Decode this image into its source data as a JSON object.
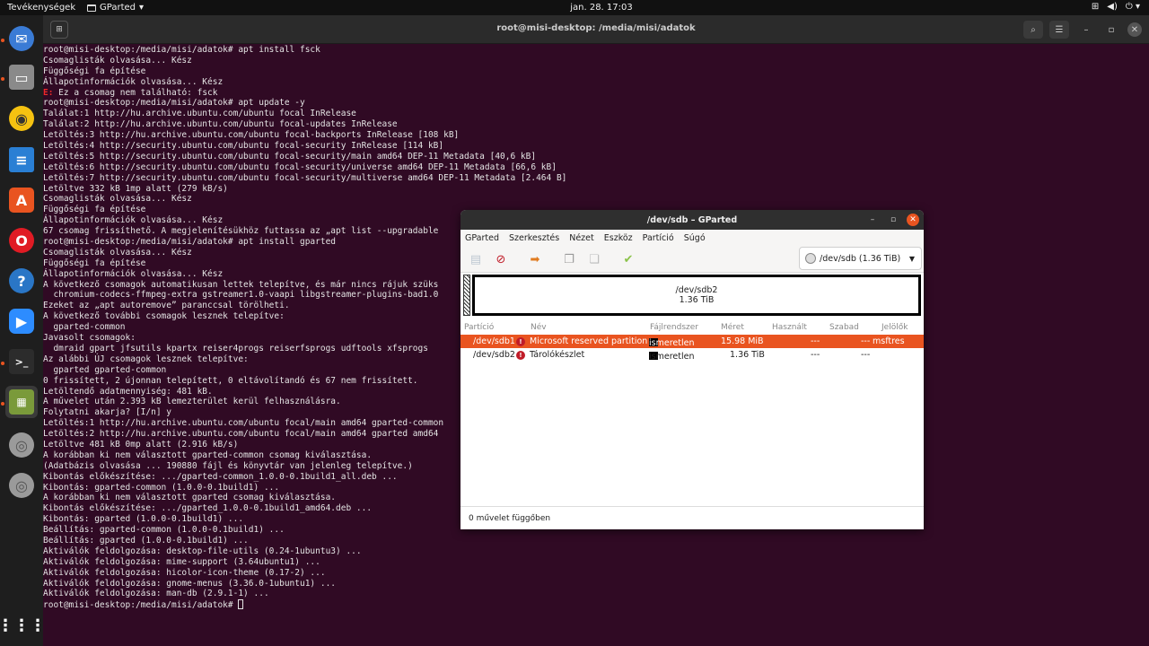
{
  "topbar": {
    "activities": "Tevékenységek",
    "app_name": "GParted",
    "clock": "jan. 28.  17:03",
    "tray_icons": [
      "network-icon",
      "volume-icon",
      "power-icon"
    ]
  },
  "dock": {
    "items": [
      {
        "name": "Thunderbird",
        "icon": "mail-icon",
        "color": "#3a7bd5"
      },
      {
        "name": "Files",
        "icon": "folder-icon",
        "color": "#8a8a8a"
      },
      {
        "name": "Rhythmbox",
        "icon": "music-icon",
        "color": "#f5c211"
      },
      {
        "name": "LibreOffice Writer",
        "icon": "writer-icon",
        "color": "#2a7fd4"
      },
      {
        "name": "Ubuntu Software",
        "icon": "software-icon",
        "color": "#e95420"
      },
      {
        "name": "Opera",
        "icon": "opera-icon",
        "color": "#e01b24"
      },
      {
        "name": "Help",
        "icon": "help-icon",
        "color": "#2a76c6"
      },
      {
        "name": "Zoom",
        "icon": "zoom-icon",
        "color": "#2d8cff"
      },
      {
        "name": "Terminal",
        "icon": "terminal-icon",
        "color": "#2c2c2c"
      },
      {
        "name": "GParted",
        "icon": "gparted-icon",
        "color": "#7a9a3a"
      },
      {
        "name": "Disk 1",
        "icon": "disk-icon",
        "color": "#9a9a9a"
      },
      {
        "name": "Disk 2",
        "icon": "disk-icon",
        "color": "#9a9a9a"
      }
    ],
    "apps_grid": "show-applications-icon"
  },
  "terminal": {
    "title": "root@misi-desktop: /media/misi/adatok",
    "lines": [
      "root@misi-desktop:/media/misi/adatok# apt install fsck",
      "Csomaglisták olvasása... Kész",
      "Függőségi fa építése",
      "Állapotinformációk olvasása... Kész",
      "E: Ez a csomag nem található: fsck",
      "root@misi-desktop:/media/misi/adatok# apt update -y",
      "Találat:1 http://hu.archive.ubuntu.com/ubuntu focal InRelease",
      "Találat:2 http://hu.archive.ubuntu.com/ubuntu focal-updates InRelease",
      "Letöltés:3 http://hu.archive.ubuntu.com/ubuntu focal-backports InRelease [108 kB]",
      "Letöltés:4 http://security.ubuntu.com/ubuntu focal-security InRelease [114 kB]",
      "Letöltés:5 http://security.ubuntu.com/ubuntu focal-security/main amd64 DEP-11 Metadata [40,6 kB]",
      "Letöltés:6 http://security.ubuntu.com/ubuntu focal-security/universe amd64 DEP-11 Metadata [66,6 kB]",
      "Letöltés:7 http://security.ubuntu.com/ubuntu focal-security/multiverse amd64 DEP-11 Metadata [2.464 B]",
      "Letöltve 332 kB 1mp alatt (279 kB/s)",
      "Csomaglisták olvasása... Kész",
      "Függőségi fa építése",
      "Állapotinformációk olvasása... Kész",
      "67 csomag frissíthető. A megjelenítésükhöz futtassa az „apt list --upgradable",
      "root@misi-desktop:/media/misi/adatok# apt install gparted",
      "Csomaglisták olvasása... Kész",
      "Függőségi fa építése",
      "Állapotinformációk olvasása... Kész",
      "A következő csomagok automatikusan lettek telepítve, és már nincs rájuk szüks",
      "  chromium-codecs-ffmpeg-extra gstreamer1.0-vaapi libgstreamer-plugins-bad1.0",
      "Ezeket az „apt autoremove” paranccsal törölheti.",
      "A következő további csomagok lesznek telepítve:",
      "  gparted-common",
      "Javasolt csomagok:",
      "  dmraid gpart jfsutils kpartx reiser4progs reiserfsprogs udftools xfsprogs",
      "Az alábbi ÚJ csomagok lesznek telepítve:",
      "  gparted gparted-common",
      "0 frissített, 2 újonnan telepített, 0 eltávolítandó és 67 nem frissített.",
      "Letöltendő adatmennyiség: 481 kB.",
      "A művelet után 2.393 kB lemezterület kerül felhasználásra.",
      "Folytatni akarja? [I/n] y",
      "Letöltés:1 http://hu.archive.ubuntu.com/ubuntu focal/main amd64 gparted-common",
      "Letöltés:2 http://hu.archive.ubuntu.com/ubuntu focal/main amd64 gparted amd64",
      "Letöltve 481 kB 0mp alatt (2.916 kB/s)",
      "A korábban ki nem választott gparted-common csomag kiválasztása.",
      "(Adatbázis olvasása ... 190880 fájl és könyvtár van jelenleg telepítve.)",
      "Kibontás előkészítése: .../gparted-common_1.0.0-0.1build1_all.deb ...",
      "Kibontás: gparted-common (1.0.0-0.1build1) ...",
      "A korábban ki nem választott gparted csomag kiválasztása.",
      "Kibontás előkészítése: .../gparted_1.0.0-0.1build1_amd64.deb ...",
      "Kibontás: gparted (1.0.0-0.1build1) ...",
      "Beállítás: gparted-common (1.0.0-0.1build1) ...",
      "Beállítás: gparted (1.0.0-0.1build1) ...",
      "Aktiválók feldolgozása: desktop-file-utils (0.24-1ubuntu3) ...",
      "Aktiválók feldolgozása: mime-support (3.64ubuntu1) ...",
      "Aktiválók feldolgozása: hicolor-icon-theme (0.17-2) ...",
      "Aktiválók feldolgozása: gnome-menus (3.36.0-1ubuntu1) ...",
      "Aktiválók feldolgozása: man-db (2.9.1-1) ..."
    ],
    "prompt": "root@misi-desktop:/media/misi/adatok# "
  },
  "gparted": {
    "title": "/dev/sdb – GParted",
    "menu": [
      "GParted",
      "Szerkesztés",
      "Nézet",
      "Eszköz",
      "Partíció",
      "Súgó"
    ],
    "toolbar_icons": [
      "new-partition-icon",
      "delete-icon",
      "resize-icon",
      "copy-icon",
      "paste-icon",
      "apply-icon"
    ],
    "device": "/dev/sdb (1.36 TiB)",
    "map": {
      "name": "/dev/sdb2",
      "size": "1.36 TiB"
    },
    "columns": [
      "Partíció",
      "Név",
      "Fájlrendszer",
      "Méret",
      "Használt",
      "Szabad",
      "Jelölők"
    ],
    "rows": [
      {
        "partition": "/dev/sdb1",
        "name": "Microsoft reserved partition",
        "fs": "ismeretlen",
        "size": "15.98 MiB",
        "used": "---",
        "free": "---",
        "flags": "msftres"
      },
      {
        "partition": "/dev/sdb2",
        "name": "Tárolókészlet",
        "fs": "ismeretlen",
        "size": "1.36 TiB",
        "used": "---",
        "free": "---",
        "flags": ""
      }
    ],
    "status": "0 művelet függőben",
    "accent": "#e95420"
  }
}
